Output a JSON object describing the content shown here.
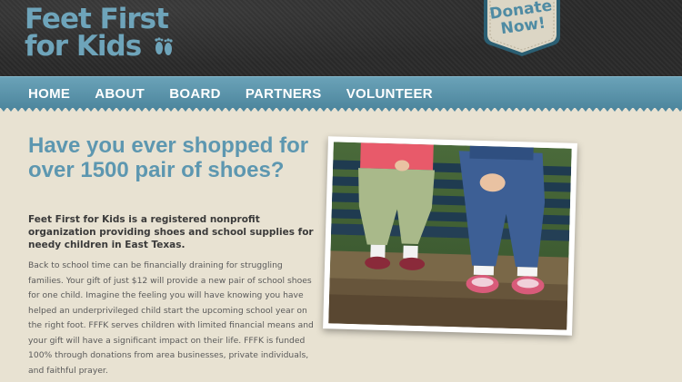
{
  "site": {
    "logo_line1": "Feet First",
    "logo_line2": "for Kids",
    "donate_line1": "Donate",
    "donate_line2": "Now!"
  },
  "nav": {
    "items": [
      "HOME",
      "ABOUT",
      "BOARD",
      "PARTNERS",
      "VOLUNTEER"
    ]
  },
  "main": {
    "headline": "Have you ever shopped for over 1500 pair of shoes?",
    "intro": "Feet First for Kids is a registered nonprofit organization providing shoes and school supplies for needy children in East Texas.",
    "body": "Back to school time can be financially draining for struggling families. Your gift of just $12 will provide a new pair of school shoes for one child. Imagine the feeling you will have knowing you have helped an underprivileged child start the upcoming school year on the right foot. FFFK serves children with limited financial means and your gift will have a significant impact on their life. FFFK is funded 100% through donations from area businesses, private individuals, and faithful prayer."
  },
  "colors": {
    "brand_blue": "#5d97b0",
    "header_dark": "#2a2a2a",
    "page_bg": "#e8e2d2"
  },
  "icons": {
    "logo_mark": "footprints-icon",
    "donate": "shield-badge"
  }
}
